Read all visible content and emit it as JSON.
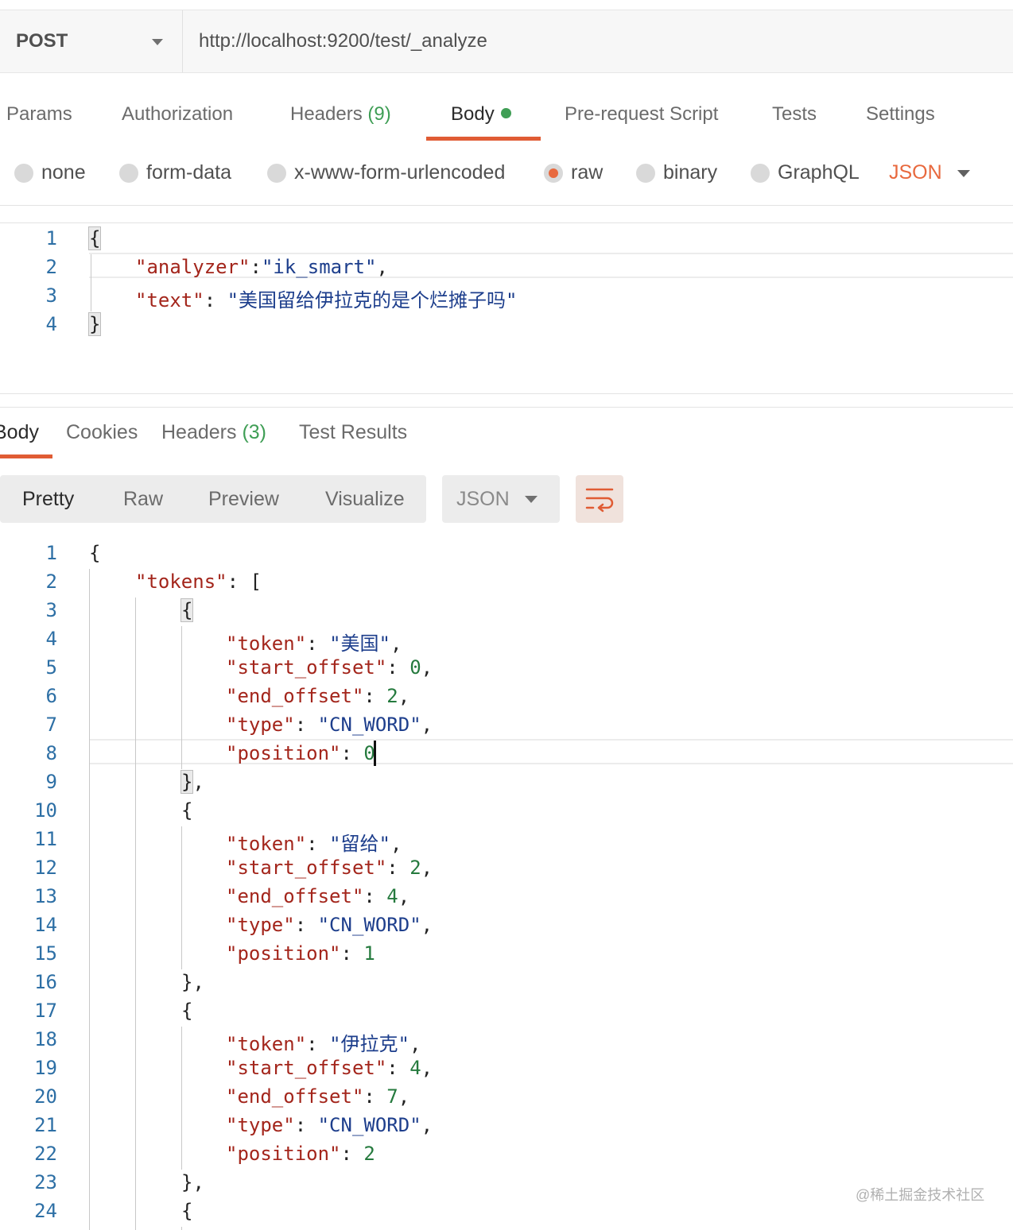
{
  "request": {
    "method": "POST",
    "url": "http://localhost:9200/test/_analyze"
  },
  "request_tabs": {
    "params": "Params",
    "authorization": "Authorization",
    "headers": "Headers",
    "headers_count": "(9)",
    "body": "Body",
    "pre_request_script": "Pre-request Script",
    "tests": "Tests",
    "settings": "Settings"
  },
  "body_types": {
    "none": "none",
    "form_data": "form-data",
    "urlencoded": "x-www-form-urlencoded",
    "raw": "raw",
    "binary": "binary",
    "graphql": "GraphQL",
    "selected": "raw",
    "format": "JSON"
  },
  "request_body": {
    "line_numbers": [
      "1",
      "2",
      "3",
      "4"
    ],
    "open": "{",
    "analyzer_key": "\"analyzer\"",
    "analyzer_value": "\"ik_smart\"",
    "text_key": "\"text\"",
    "text_value": "\"美国留给伊拉克的是个烂摊子吗\"",
    "close": "}"
  },
  "response_tabs": {
    "body": "Body",
    "cookies": "Cookies",
    "headers": "Headers",
    "headers_count": "(3)",
    "test_results": "Test Results"
  },
  "response_toolbar": {
    "pretty": "Pretty",
    "raw": "Raw",
    "preview": "Preview",
    "visualize": "Visualize",
    "format": "JSON",
    "wrap_icon": "wrap-lines-icon"
  },
  "response_body": {
    "line_numbers": [
      "1",
      "2",
      "3",
      "4",
      "5",
      "6",
      "7",
      "8",
      "9",
      "10",
      "11",
      "12",
      "13",
      "14",
      "15",
      "16",
      "17",
      "18",
      "19",
      "20",
      "21",
      "22",
      "23",
      "24"
    ],
    "tokens_key": "\"tokens\"",
    "items": [
      {
        "token": "\"美国\"",
        "start_offset": "0",
        "end_offset": "2",
        "type": "\"CN_WORD\"",
        "position": "0"
      },
      {
        "token": "\"留给\"",
        "start_offset": "2",
        "end_offset": "4",
        "type": "\"CN_WORD\"",
        "position": "1"
      },
      {
        "token": "\"伊拉克\"",
        "start_offset": "4",
        "end_offset": "7",
        "type": "\"CN_WORD\"",
        "position": "2"
      }
    ]
  },
  "watermark": "@稀土掘金技术社区",
  "colors": {
    "accent": "#e05c34",
    "count_green": "#3f9e55",
    "json_key": "#a3251b",
    "json_string": "#1d3e8c",
    "json_number": "#257a3e",
    "line_number": "#2d6fa5"
  }
}
